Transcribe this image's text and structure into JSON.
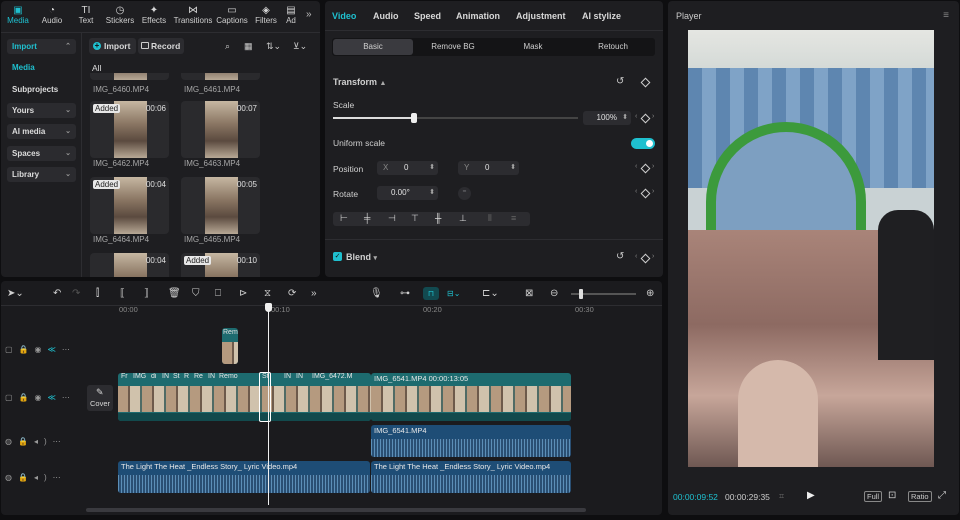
{
  "media_panel": {
    "tabs": [
      {
        "label": "Media",
        "icon": "media-icon"
      },
      {
        "label": "Audio",
        "icon": "audio-icon"
      },
      {
        "label": "Text",
        "icon": "text-icon"
      },
      {
        "label": "Stickers",
        "icon": "stickers-icon"
      },
      {
        "label": "Effects",
        "icon": "effects-icon"
      },
      {
        "label": "Transitions",
        "icon": "transitions-icon"
      },
      {
        "label": "Captions",
        "icon": "captions-icon"
      },
      {
        "label": "Filters",
        "icon": "filters-icon"
      },
      {
        "label": "Ad",
        "icon": "ad-icon"
      }
    ],
    "sidebar": [
      "Import",
      "Media",
      "Subprojects",
      "Yours",
      "AI media",
      "Spaces",
      "Library"
    ],
    "import_label": "Import",
    "record_label": "Record",
    "filter_label": "All",
    "items": [
      {
        "name": "IMG_6460.MP4",
        "duration": "",
        "added": false
      },
      {
        "name": "IMG_6461.MP4",
        "duration": "",
        "added": false
      },
      {
        "name": "IMG_6462.MP4",
        "duration": "00:06",
        "added": true
      },
      {
        "name": "IMG_6463.MP4",
        "duration": "00:07",
        "added": false
      },
      {
        "name": "IMG_6464.MP4",
        "duration": "00:04",
        "added": true
      },
      {
        "name": "IMG_6465.MP4",
        "duration": "00:05",
        "added": false
      },
      {
        "name": "",
        "duration": "00:04",
        "added": false
      },
      {
        "name": "",
        "duration": "00:10",
        "added": true
      }
    ],
    "added_label": "Added"
  },
  "properties": {
    "tabs": [
      "Video",
      "Audio",
      "Speed",
      "Animation",
      "Adjustment",
      "AI stylize"
    ],
    "subtabs": [
      "Basic",
      "Remove BG",
      "Mask",
      "Retouch"
    ],
    "transform_label": "Transform",
    "scale_label": "Scale",
    "scale_value": "100%",
    "scale_fraction": 0.33,
    "uniform_scale_label": "Uniform scale",
    "position_label": "Position",
    "pos_x_label": "X",
    "pos_x": "0",
    "pos_y_label": "Y",
    "pos_y": "0",
    "rotate_label": "Rotate",
    "rotate_value": "0.00°",
    "blend_label": "Blend"
  },
  "player": {
    "title": "Player",
    "current_time": "00:00:09:52",
    "total_time": "00:00:29:35",
    "full_label": "Full",
    "ratio_label": "Ratio"
  },
  "timeline": {
    "ruler": [
      "00:00",
      "00:10",
      "00:20",
      "00:30"
    ],
    "cover_label": "Cover",
    "clip_top": "Rem",
    "main_labels": [
      "Fr",
      "IMG",
      "di",
      "IN",
      "St",
      "R",
      "Re",
      "IN",
      "Remo",
      "St",
      "IN",
      "IN",
      "IMG_6472.M"
    ],
    "main_clip2": "IMG_6541.MP4  00:00:13:05",
    "audio_clip1": "IMG_6541.MP4",
    "music_clip1": "The Light The Heat _Endless Story_ Lyric Video.mp4",
    "music_clip2": "The Light The Heat _Endless Story_ Lyric Video.mp4"
  },
  "colors": {
    "accent": "#1fc0cf",
    "clip_teal": "#1d6b6f",
    "audio_blue": "#1e4d76"
  }
}
